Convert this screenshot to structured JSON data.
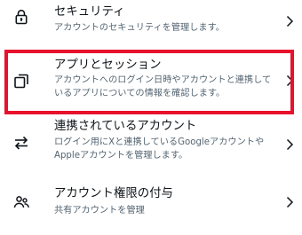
{
  "settings": {
    "items": [
      {
        "title": "セキュリティ",
        "subtitle": "アカウントのセキュリティを管理します。",
        "icon": "lock-icon"
      },
      {
        "title": "アプリとセッション",
        "subtitle": "アカウントへのログイン日時やアカウントと連携しているアプリについての情報を確認します。",
        "icon": "stacked-windows-icon"
      },
      {
        "title": "連携されているアカウント",
        "subtitle": "ログイン用にXと連携しているGoogleアカウントやAppleアカウントを管理します。",
        "icon": "swap-arrows-icon"
      },
      {
        "title": "アカウント権限の付与",
        "subtitle": "共有アカウントを管理",
        "icon": "people-icon"
      }
    ]
  },
  "highlight_color": "#e8112d",
  "text_color": "#0f1419",
  "subtext_color": "#536471"
}
